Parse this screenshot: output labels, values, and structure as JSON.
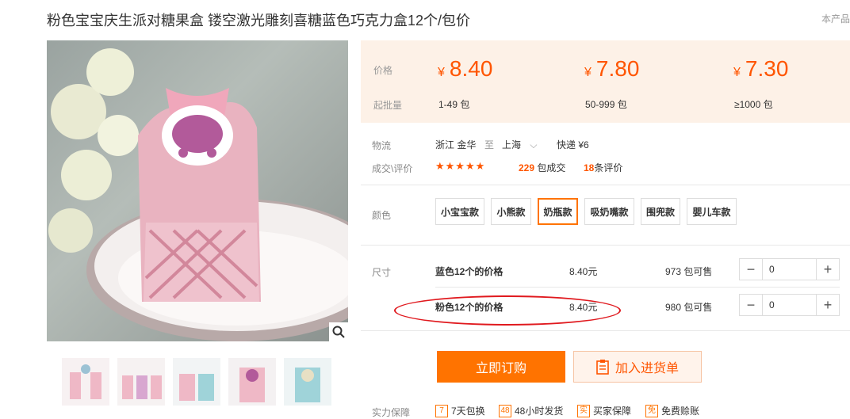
{
  "product": {
    "title": "粉色宝宝庆生派对糖果盒 镂空激光雕刻喜糖蓝色巧克力盒12个/包价",
    "corner_text": "本产品"
  },
  "price_table": {
    "price_label": "价格",
    "moq_label": "起批量",
    "tiers": [
      {
        "currency": "¥",
        "price": "8.40",
        "moq": "1-49 包"
      },
      {
        "currency": "¥",
        "price": "7.80",
        "moq": "50-999 包"
      },
      {
        "currency": "¥",
        "price": "7.30",
        "moq": "≥1000 包"
      }
    ]
  },
  "logistics": {
    "label": "物流",
    "from": "浙江 金华",
    "to_word": "至",
    "to": "上海",
    "shipping": "快递 ¥6"
  },
  "deals": {
    "label": "成交\\评价",
    "stars": "★★★★★",
    "deal_count": "229",
    "deal_unit": "包成交",
    "review_count": "18",
    "review_unit": "条评价"
  },
  "color": {
    "label": "颜色",
    "options": [
      "小宝宝款",
      "小熊款",
      "奶瓶款",
      "吸奶嘴款",
      "围兜款",
      "婴儿车款"
    ],
    "selected": "奶瓶款"
  },
  "size": {
    "label": "尺寸",
    "rows": [
      {
        "name": "蓝色12个的价格",
        "price": "8.40元",
        "stock": "973 包可售",
        "qty": "0"
      },
      {
        "name": "粉色12个的价格",
        "price": "8.40元",
        "stock": "980 包可售",
        "qty": "0"
      }
    ]
  },
  "actions": {
    "buy_now": "立即订购",
    "add_to_cart": "加入进货单"
  },
  "services": {
    "label": "实力保障",
    "items": [
      {
        "icon": "7",
        "text": "7天包换"
      },
      {
        "icon": "48",
        "text": "48小时发货"
      },
      {
        "icon": "实",
        "text": "买家保障"
      },
      {
        "icon": "免",
        "text": "免费赊账"
      }
    ]
  },
  "colors": {
    "accent": "#ff7300",
    "price": "#ff5500",
    "price_bg": "#fdf1e7",
    "annotation": "#e0191e"
  }
}
